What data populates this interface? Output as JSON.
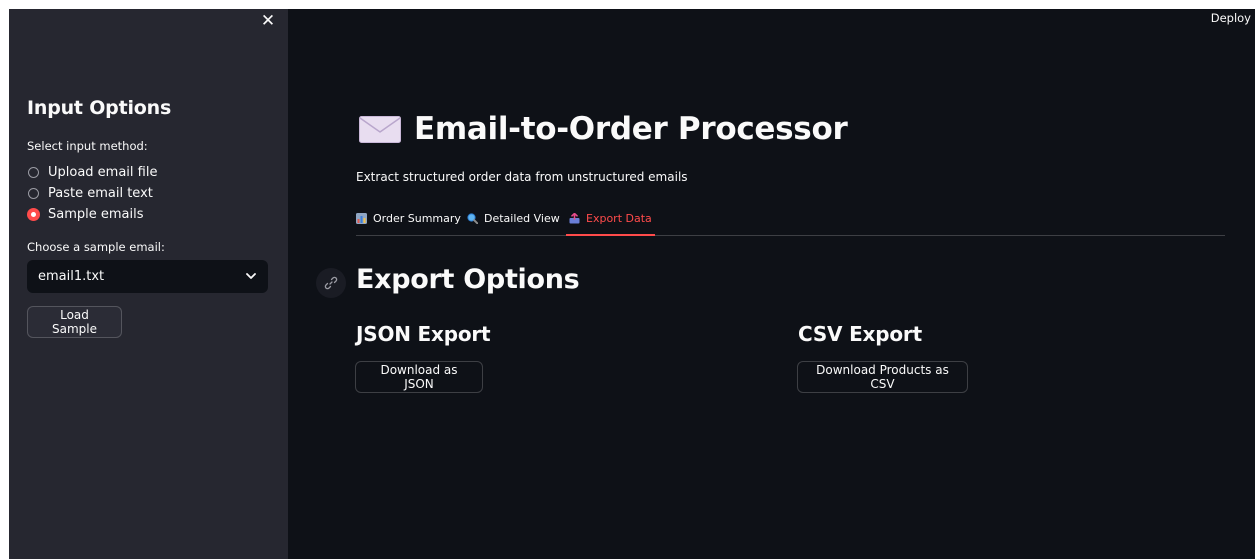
{
  "header": {
    "deploy_label": "Deploy"
  },
  "sidebar": {
    "close_icon": "close-icon",
    "title": "Input Options",
    "input_method_label": "Select input method:",
    "input_methods": [
      {
        "label": "Upload email file",
        "checked": false
      },
      {
        "label": "Paste email text",
        "checked": false
      },
      {
        "label": "Sample emails",
        "checked": true
      }
    ],
    "sample_label": "Choose a sample email:",
    "sample_select": {
      "value": "email1.txt"
    },
    "load_button": "Load Sample"
  },
  "main": {
    "title_icon": "envelope-icon",
    "title": "Email-to-Order Processor",
    "subtitle": "Extract structured order data from unstructured emails",
    "tabs": [
      {
        "label": "Order Summary",
        "icon": "bar-chart-icon",
        "active": false
      },
      {
        "label": "Detailed View",
        "icon": "magnifier-icon",
        "active": false
      },
      {
        "label": "Export Data",
        "icon": "outbox-tray-icon",
        "active": true
      }
    ],
    "export": {
      "title": "Export Options",
      "json_heading": "JSON Export",
      "json_button": "Download as JSON",
      "csv_heading": "CSV Export",
      "csv_button": "Download Products as CSV"
    }
  },
  "colors": {
    "app_background": "#0e1117",
    "sidebar_background": "#262730",
    "accent": "#ff4b4b",
    "text": "#fafafa"
  }
}
